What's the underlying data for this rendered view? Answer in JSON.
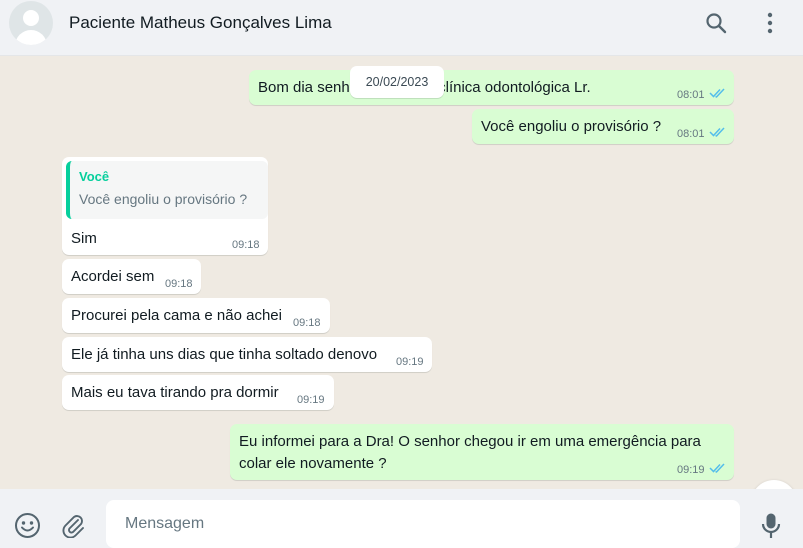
{
  "header": {
    "contact_name": "Paciente Matheus Gonçalves Lima",
    "icons": [
      "avatar-placeholder",
      "search-icon",
      "menu-dots-icon"
    ]
  },
  "chat": {
    "date_badge": "20/02/2023",
    "messages": [
      {
        "direction": "out",
        "text": "Bom dia senhor! Aqui é da clínica odontológica Lr.",
        "time": "08:01",
        "status": "read"
      },
      {
        "direction": "out",
        "text": "Você engoliu o provisório ?",
        "time": "08:01",
        "status": "read"
      },
      {
        "direction": "in",
        "reply_to": {
          "author": "Você",
          "text": "Você engoliu o provisório ?"
        },
        "text": "Sim",
        "time": "09:18"
      },
      {
        "direction": "in",
        "text": "Acordei sem",
        "time": "09:18"
      },
      {
        "direction": "in",
        "text": "Procurei pela cama e não achei",
        "time": "09:18"
      },
      {
        "direction": "in",
        "text": "Ele já tinha uns dias que tinha soltado denovo",
        "time": "09:19"
      },
      {
        "direction": "in",
        "text": "Mais eu tava tirando pra dormir",
        "time": "09:19"
      },
      {
        "direction": "out",
        "text_lines": [
          "Eu informei para a Dra! O senhor chegou ir em uma emergência para",
          "colar ele novamente ?"
        ],
        "time": "09:19",
        "status": "read"
      }
    ]
  },
  "footer": {
    "input_placeholder": "Mensagem",
    "icons": [
      "emoji-icon",
      "attach-icon",
      "mic-icon"
    ]
  },
  "colors": {
    "outgoing_bubble": "#d9fdd3",
    "incoming_bubble": "#ffffff",
    "chat_background": "#efeae2",
    "read_tick": "#53bdeb",
    "quote_accent": "#06cf9c"
  }
}
